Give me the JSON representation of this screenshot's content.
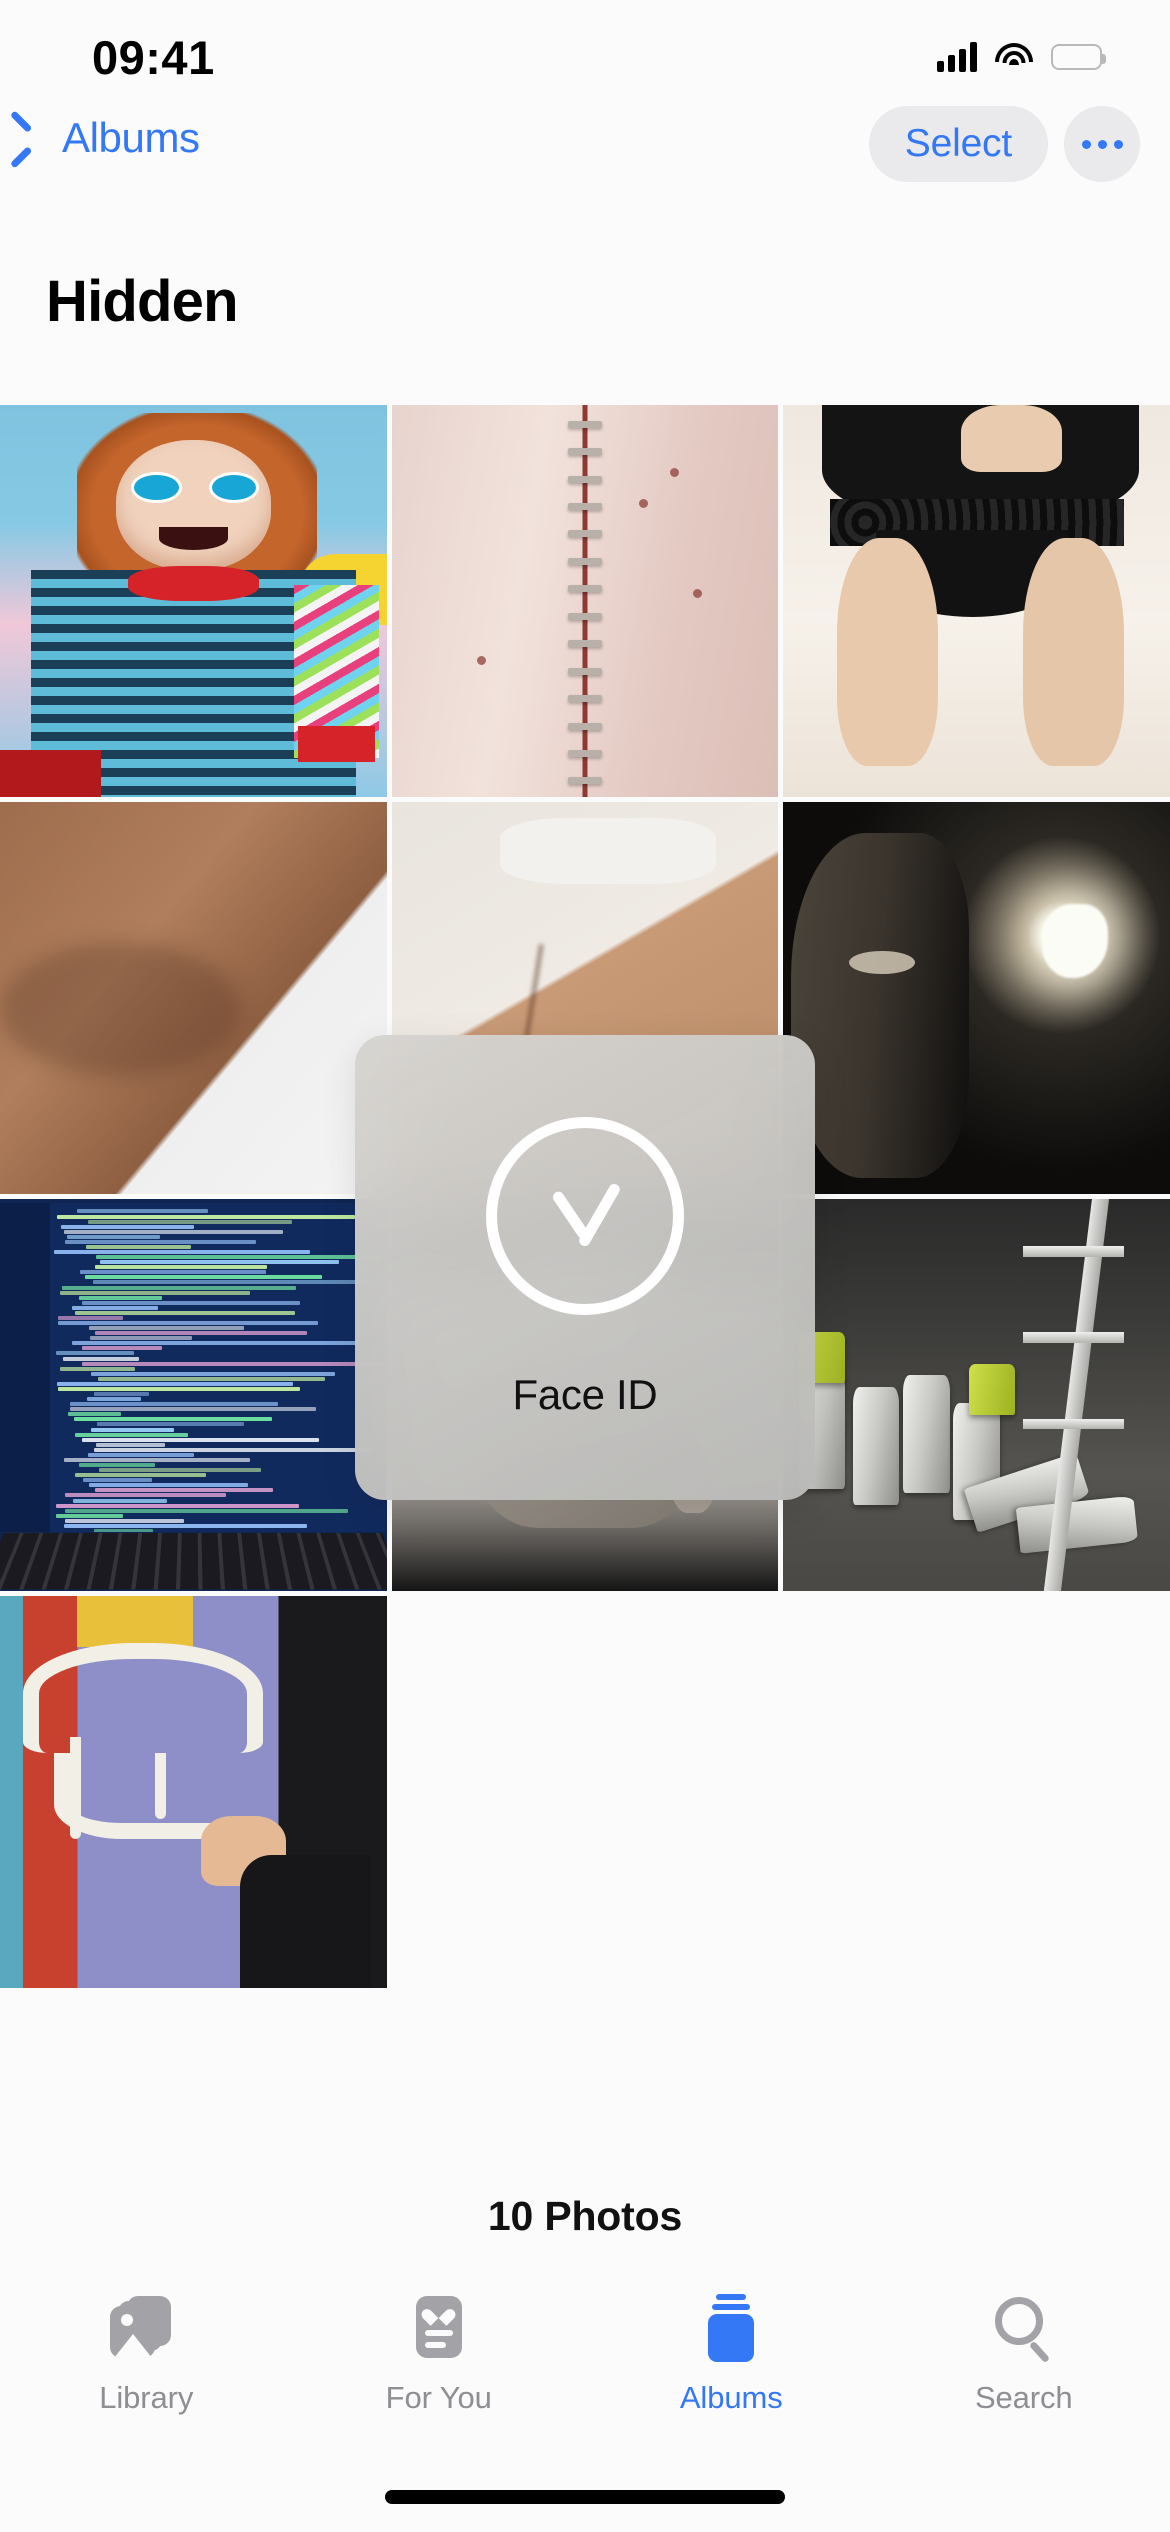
{
  "status_bar": {
    "time": "09:41",
    "icons": {
      "cellular": "signal-bars-icon",
      "wifi": "wifi-icon",
      "battery": "battery-full-icon"
    }
  },
  "nav_bar": {
    "back_label": "Albums",
    "back_icon": "chevron-left-icon",
    "select_label": "Select",
    "more_icon": "ellipsis-icon"
  },
  "page": {
    "title": "Hidden",
    "photo_count_label": "10 Photos"
  },
  "face_id": {
    "label": "Face ID",
    "icon": "checkmark-circle-icon"
  },
  "grid": {
    "columns": 3,
    "photos": [
      {
        "index": 1,
        "alt": "chucky-doll-photo"
      },
      {
        "index": 2,
        "alt": "surgical-scar-photo"
      },
      {
        "index": 3,
        "alt": "lingerie-photo"
      },
      {
        "index": 4,
        "alt": "torso-skin-photo"
      },
      {
        "index": 5,
        "alt": "hip-underwear-photo"
      },
      {
        "index": 6,
        "alt": "dark-face-light-photo"
      },
      {
        "index": 7,
        "alt": "code-screen-photo"
      },
      {
        "index": 8,
        "alt": "black-white-torso-photo"
      },
      {
        "index": 9,
        "alt": "spray-cans-photo"
      },
      {
        "index": 10,
        "alt": "graffiti-wall-photo"
      }
    ]
  },
  "tab_bar": {
    "items": [
      {
        "label": "Library",
        "icon": "library-icon",
        "active": false
      },
      {
        "label": "For You",
        "icon": "heart-card-icon",
        "active": false
      },
      {
        "label": "Albums",
        "icon": "albums-icon",
        "active": true
      },
      {
        "label": "Search",
        "icon": "magnifier-icon",
        "active": false
      }
    ]
  },
  "colors": {
    "accent": "#3478f6",
    "inactive": "#8e8e93",
    "background": "#fbfbfb",
    "chip": "#eaeaec"
  }
}
